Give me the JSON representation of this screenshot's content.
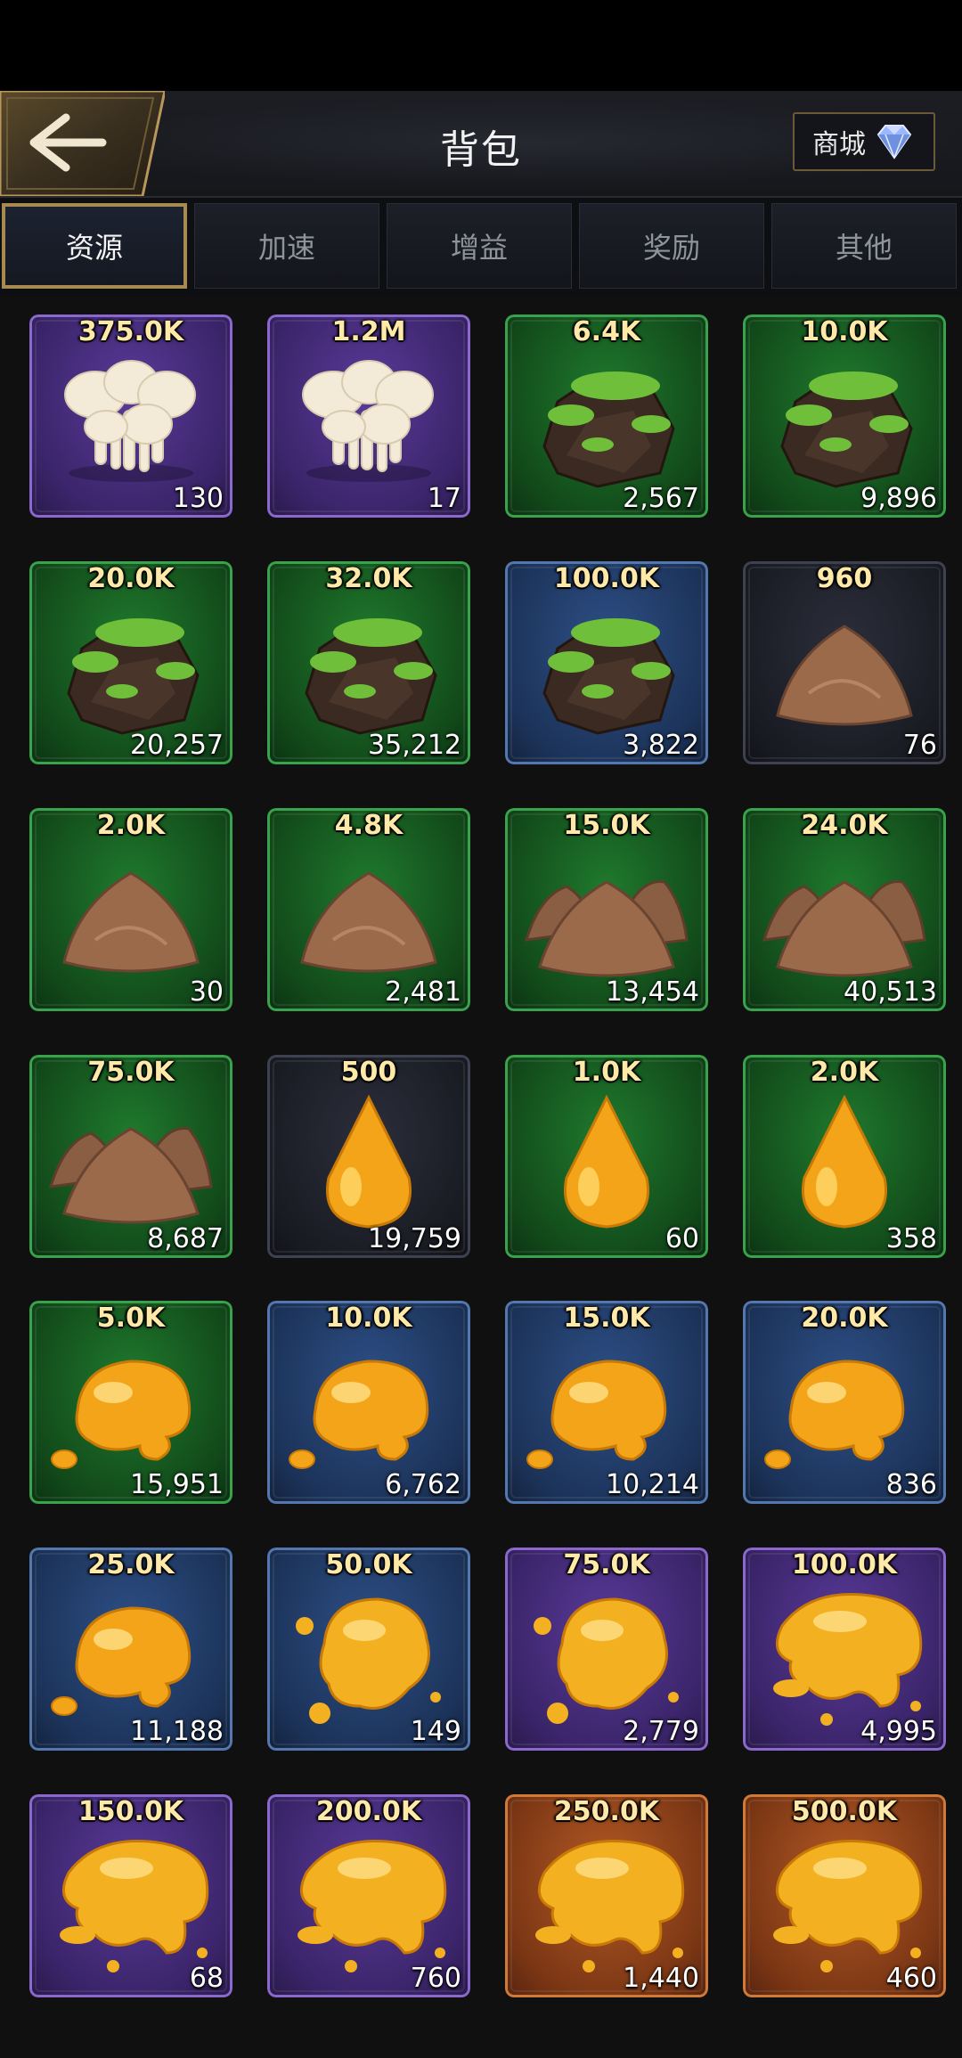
{
  "header": {
    "title": "背包",
    "shop_label": "商城"
  },
  "tabs": [
    {
      "label": "资源",
      "active": true
    },
    {
      "label": "加速",
      "active": false
    },
    {
      "label": "增益",
      "active": false
    },
    {
      "label": "奖励",
      "active": false
    },
    {
      "label": "其他",
      "active": false
    }
  ],
  "items": [
    {
      "value": "375.0K",
      "count": "130",
      "rarity": "purple",
      "icon": "mushroom-icon"
    },
    {
      "value": "1.2M",
      "count": "17",
      "rarity": "purple",
      "icon": "mushroom-icon"
    },
    {
      "value": "6.4K",
      "count": "2,567",
      "rarity": "green",
      "icon": "mossy-rock-icon"
    },
    {
      "value": "10.0K",
      "count": "9,896",
      "rarity": "green",
      "icon": "mossy-rock-icon"
    },
    {
      "value": "20.0K",
      "count": "20,257",
      "rarity": "green",
      "icon": "mossy-rock-icon"
    },
    {
      "value": "32.0K",
      "count": "35,212",
      "rarity": "green",
      "icon": "mossy-rock-icon"
    },
    {
      "value": "100.0K",
      "count": "3,822",
      "rarity": "blue",
      "icon": "mossy-rock-icon"
    },
    {
      "value": "960",
      "count": "76",
      "rarity": "dark",
      "icon": "soil-pile-icon"
    },
    {
      "value": "2.0K",
      "count": "30",
      "rarity": "green",
      "icon": "soil-pile-icon"
    },
    {
      "value": "4.8K",
      "count": "2,481",
      "rarity": "green",
      "icon": "soil-pile-icon"
    },
    {
      "value": "15.0K",
      "count": "13,454",
      "rarity": "green",
      "icon": "soil-piles-icon"
    },
    {
      "value": "24.0K",
      "count": "40,513",
      "rarity": "green",
      "icon": "soil-piles-icon"
    },
    {
      "value": "75.0K",
      "count": "8,687",
      "rarity": "green",
      "icon": "soil-piles-icon"
    },
    {
      "value": "500",
      "count": "19,759",
      "rarity": "dark",
      "icon": "honey-drop-icon"
    },
    {
      "value": "1.0K",
      "count": "60",
      "rarity": "green",
      "icon": "honey-drop-icon"
    },
    {
      "value": "2.0K",
      "count": "358",
      "rarity": "green",
      "icon": "honey-drop-icon"
    },
    {
      "value": "5.0K",
      "count": "15,951",
      "rarity": "green",
      "icon": "honey-blob-icon"
    },
    {
      "value": "10.0K",
      "count": "6,762",
      "rarity": "blue",
      "icon": "honey-blob-icon"
    },
    {
      "value": "15.0K",
      "count": "10,214",
      "rarity": "blue",
      "icon": "honey-blob-icon"
    },
    {
      "value": "20.0K",
      "count": "836",
      "rarity": "blue",
      "icon": "honey-blob-icon"
    },
    {
      "value": "25.0K",
      "count": "11,188",
      "rarity": "blue",
      "icon": "honey-blob-icon"
    },
    {
      "value": "50.0K",
      "count": "149",
      "rarity": "blue",
      "icon": "honey-splash-icon"
    },
    {
      "value": "75.0K",
      "count": "2,779",
      "rarity": "purple",
      "icon": "honey-splash-icon"
    },
    {
      "value": "100.0K",
      "count": "4,995",
      "rarity": "purple",
      "icon": "honey-puddle-icon"
    },
    {
      "value": "150.0K",
      "count": "68",
      "rarity": "purple",
      "icon": "honey-puddle-icon"
    },
    {
      "value": "200.0K",
      "count": "760",
      "rarity": "purple",
      "icon": "honey-puddle-icon"
    },
    {
      "value": "250.0K",
      "count": "1,440",
      "rarity": "orange",
      "icon": "honey-puddle-icon"
    },
    {
      "value": "500.0K",
      "count": "460",
      "rarity": "orange",
      "icon": "honey-puddle-icon"
    }
  ]
}
